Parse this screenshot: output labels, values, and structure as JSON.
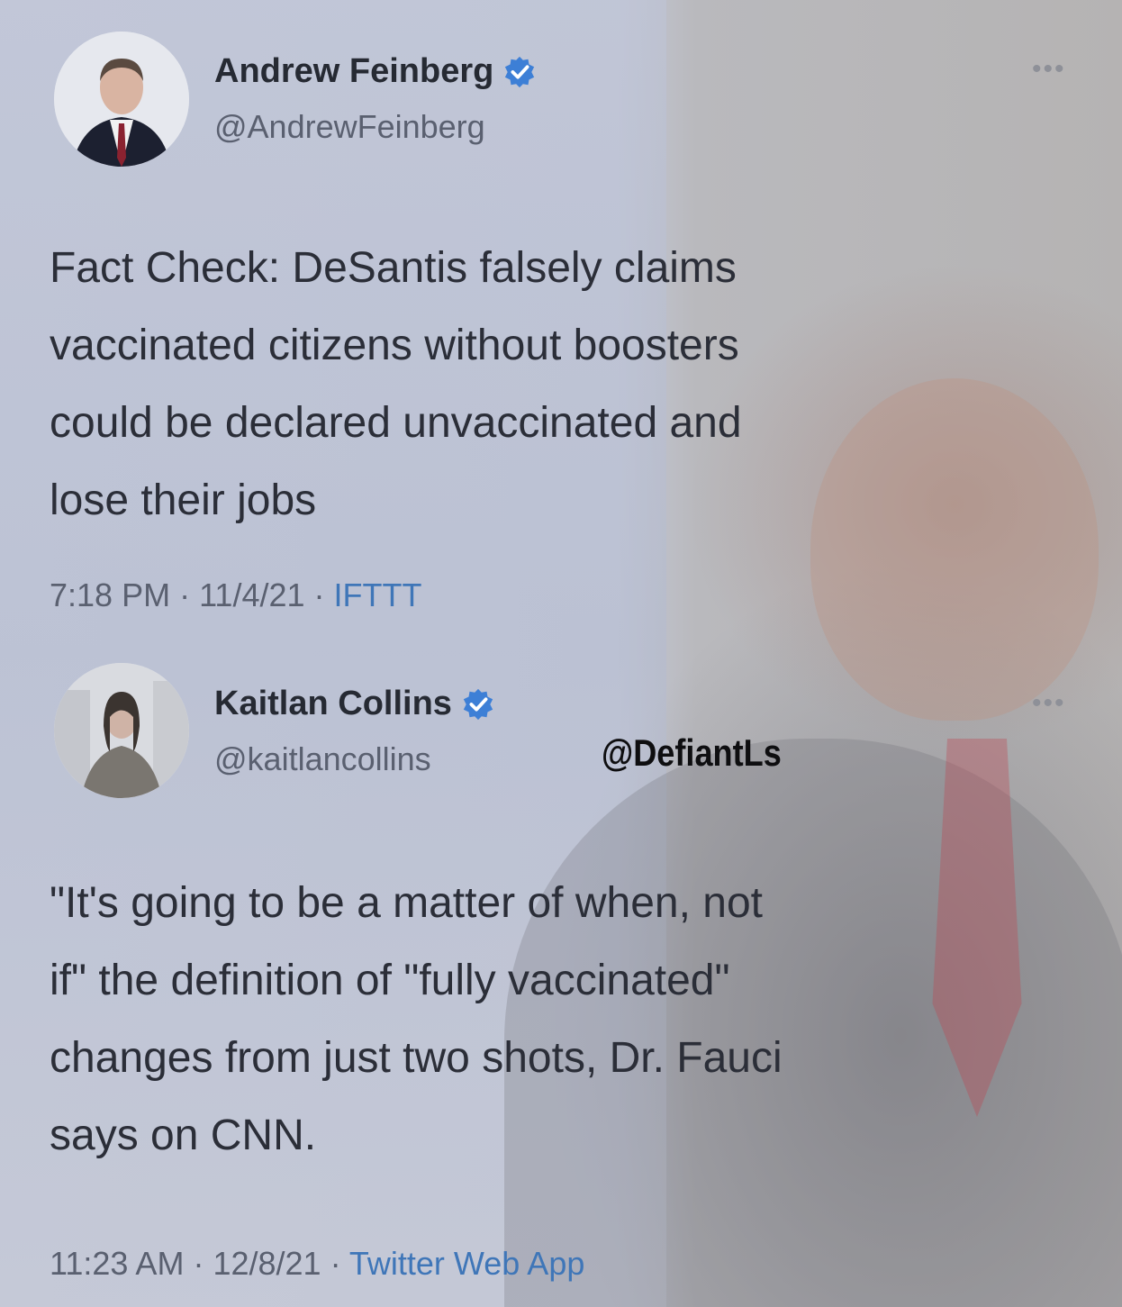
{
  "tweets": [
    {
      "author_name": "Andrew Feinberg",
      "handle": "@AndrewFeinberg",
      "verified": true,
      "text": "Fact Check: DeSantis falsely claims\nvaccinated citizens without boosters\ncould be declared unvaccinated and\nlose their jobs",
      "time": "7:18 PM",
      "date": "11/4/21",
      "source": "IFTTT",
      "more_icon": "more-options-icon"
    },
    {
      "author_name": "Kaitlan Collins",
      "handle": "@kaitlancollins",
      "verified": true,
      "text": "\"It's going to be a matter of when, not\nif\" the definition of \"fully vaccinated\"\nchanges from just two shots, Dr. Fauci\nsays on CNN.",
      "time": "11:23 AM",
      "date": "12/8/21",
      "source": "Twitter Web App",
      "more_icon": "more-options-icon"
    }
  ],
  "separator": " · ",
  "watermark": "@DefiantLs",
  "colors": {
    "verified_badge": "#3d7fd6",
    "link": "#3f76b8"
  }
}
